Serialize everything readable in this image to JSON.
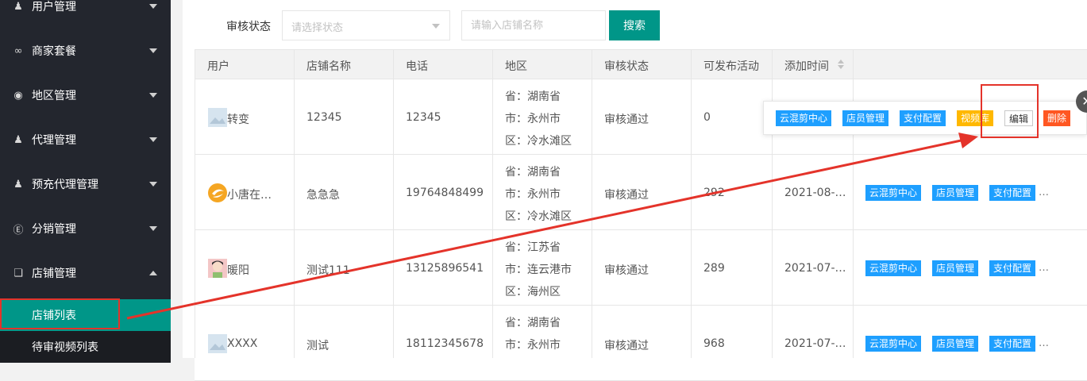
{
  "sidebar": {
    "items": [
      {
        "label": "用户管理",
        "icon": "user-group-icon"
      },
      {
        "label": "商家套餐",
        "icon": "infinity-icon"
      },
      {
        "label": "地区管理",
        "icon": "compass-icon"
      },
      {
        "label": "代理管理",
        "icon": "person-icon"
      },
      {
        "label": "预充代理管理",
        "icon": "person-icon"
      },
      {
        "label": "分销管理",
        "icon": "dollar-icon"
      },
      {
        "label": "店铺管理",
        "icon": "cube-icon"
      }
    ],
    "sub_items": [
      {
        "label": "店铺列表"
      },
      {
        "label": "待审视频列表"
      }
    ]
  },
  "filter": {
    "label": "审核状态",
    "select_placeholder": "请选择状态",
    "input_placeholder": "请输入店铺名称",
    "search_label": "搜索"
  },
  "table": {
    "headers": [
      "用户",
      "店铺名称",
      "电话",
      "地区",
      "审核状态",
      "可发布活动",
      "添加时间"
    ],
    "rows": [
      {
        "user": "转变",
        "shop": "12345",
        "phone": "12345",
        "region": [
          "省：湖南省",
          "市：永州市",
          "区：冷水滩区"
        ],
        "status": "审核通过",
        "activities": "0",
        "time": ""
      },
      {
        "user": "小唐在…",
        "shop": "急急急",
        "phone": "19764848499",
        "region": [
          "省：湖南省",
          "市：永州市",
          "区：冷水滩区"
        ],
        "status": "审核通过",
        "activities": "292",
        "time": "2021-08-…"
      },
      {
        "user": "暖阳",
        "shop": "测试111",
        "phone": "13125896541",
        "region": [
          "省：江苏省",
          "市：连云港市",
          "区：海州区"
        ],
        "status": "审核通过",
        "activities": "289",
        "time": "2021-07-…"
      },
      {
        "user": "XXXX",
        "shop": "测试",
        "phone": "18112345678",
        "region": [
          "省：湖南省",
          "市：永州市"
        ],
        "status": "审核通过",
        "activities": "968",
        "time": "2021-07-…"
      }
    ],
    "action_labels": {
      "cloud_edit": "云混剪中心",
      "staff": "店员管理",
      "payment": "支付配置",
      "video": "视频库",
      "edit": "编辑",
      "delete": "删除",
      "more": "…"
    }
  },
  "close_glyph": "✕",
  "colors": {
    "sidebar_bg": "#23262e",
    "accent": "#009688",
    "blue": "#1e9fff",
    "yellow": "#ffb800",
    "red": "#ff5722",
    "annotation": "#e4332a"
  }
}
